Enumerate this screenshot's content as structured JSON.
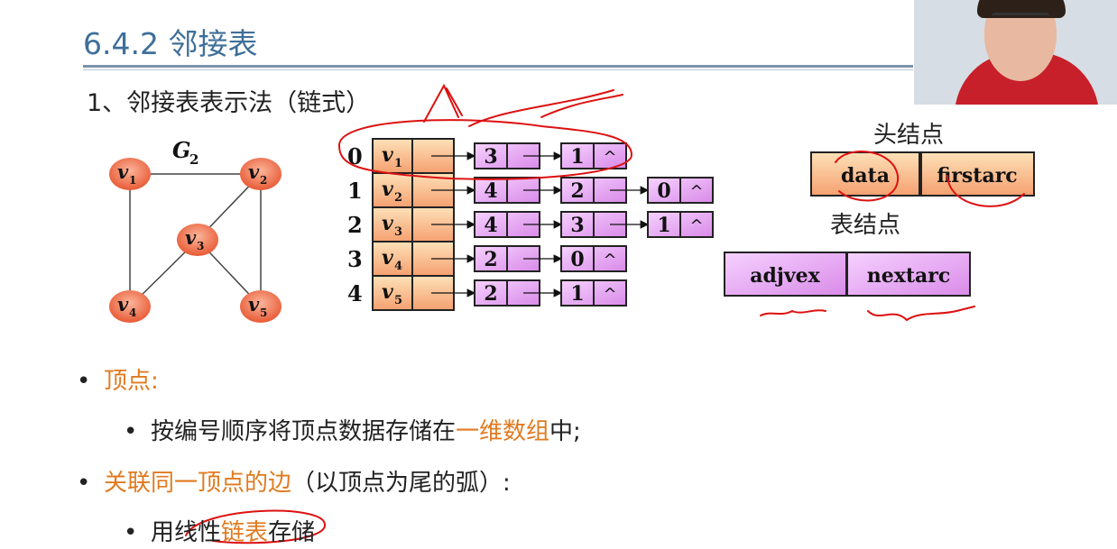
{
  "slide": {
    "title": "6.4.2 邻接表",
    "subtitle": "1、邻接表表示法（链式）"
  },
  "graph": {
    "label": "G",
    "label_sub": "2",
    "vertices": [
      {
        "name": "v",
        "sub": "1"
      },
      {
        "name": "v",
        "sub": "2"
      },
      {
        "name": "v",
        "sub": "3"
      },
      {
        "name": "v",
        "sub": "4"
      },
      {
        "name": "v",
        "sub": "5"
      }
    ]
  },
  "adjacency": {
    "rows": [
      {
        "index": "0",
        "vertex": "v",
        "sub": "1",
        "nodes": [
          "3",
          "1"
        ]
      },
      {
        "index": "1",
        "vertex": "v",
        "sub": "2",
        "nodes": [
          "4",
          "2",
          "0"
        ]
      },
      {
        "index": "2",
        "vertex": "v",
        "sub": "3",
        "nodes": [
          "4",
          "3",
          "1"
        ]
      },
      {
        "index": "3",
        "vertex": "v",
        "sub": "4",
        "nodes": [
          "2",
          "0"
        ]
      },
      {
        "index": "4",
        "vertex": "v",
        "sub": "5",
        "nodes": [
          "2",
          "1"
        ]
      }
    ],
    "null_symbol": "^"
  },
  "legend": {
    "head_title": "头结点",
    "head_fields": [
      "data",
      "firstarc"
    ],
    "table_title": "表结点",
    "table_fields": [
      "adjvex",
      "nextarc"
    ]
  },
  "bullets": [
    {
      "label": "顶点:",
      "level": 1,
      "parts": [
        {
          "t": "顶点:",
          "accent": true
        }
      ]
    },
    {
      "label": "按编号顺序将顶点数据存储在一维数组中;",
      "level": 2,
      "parts": [
        {
          "t": "按编号顺序将顶点数据存储在",
          "accent": false
        },
        {
          "t": "一维数组",
          "accent": true
        },
        {
          "t": "中;",
          "accent": false
        }
      ]
    },
    {
      "label": "关联同一顶点的边（以顶点为尾的弧）:",
      "level": 1,
      "parts": [
        {
          "t": "关联同一顶点的边",
          "accent": true
        },
        {
          "t": "（以顶点为尾的弧）:",
          "accent": false
        }
      ]
    },
    {
      "label": "用线性链表存储",
      "level": 2,
      "parts": [
        {
          "t": "用线性",
          "accent": false
        },
        {
          "t": "链表",
          "accent": true
        },
        {
          "t": "存储",
          "accent": false
        }
      ]
    }
  ],
  "colors": {
    "accent": "#e07a20",
    "title": "#3f6f99",
    "node_fill": "#f0b8ff",
    "head_fill": "#fcd3a0",
    "vertex_fill": "#f08060",
    "annotation": "#dd1111"
  }
}
